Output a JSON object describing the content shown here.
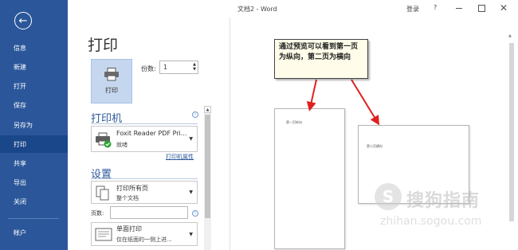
{
  "window": {
    "title": "文档2 - Word",
    "login_label": "登录",
    "help_label": "?",
    "minimize_label": "–",
    "maximize_label": "□",
    "close_label": "✕"
  },
  "sidebar": {
    "back_icon": "←",
    "items": [
      {
        "label": "信息"
      },
      {
        "label": "新建"
      },
      {
        "label": "打开"
      },
      {
        "label": "保存"
      },
      {
        "label": "另存为"
      },
      {
        "label": "打印",
        "active": true
      },
      {
        "label": "共享"
      },
      {
        "label": "导出"
      },
      {
        "label": "关闭"
      },
      {
        "label": "帐户"
      }
    ],
    "accent_color": "#2b579a",
    "active_color": "#19478a"
  },
  "print_panel": {
    "heading": "打印",
    "print_button_label": "打印",
    "copies_label": "份数:",
    "copies_value": "1",
    "printer_section": "打印机",
    "printer_name": "Foxit Reader PDF Pri...",
    "printer_status": "就绪",
    "printer_properties_link": "打印机属性",
    "settings_section": "设置",
    "setting_print_range": {
      "main": "打印所有页",
      "sub": "整个文档"
    },
    "pages_label": "页数:",
    "pages_value": "",
    "setting_sides": {
      "main": "单面打印",
      "sub": "仅在纸面的一侧上进..."
    }
  },
  "preview": {
    "page1_text": "第一页纵向",
    "page2_text": "第二页横向",
    "callout_text": "通过预览可以看到第一页为纵向，第二页为横向",
    "arrow_color": "#e02020"
  },
  "watermark": {
    "logo_glyph": "S",
    "name": "搜狗指南",
    "url": "zhihan.sogou.com"
  }
}
